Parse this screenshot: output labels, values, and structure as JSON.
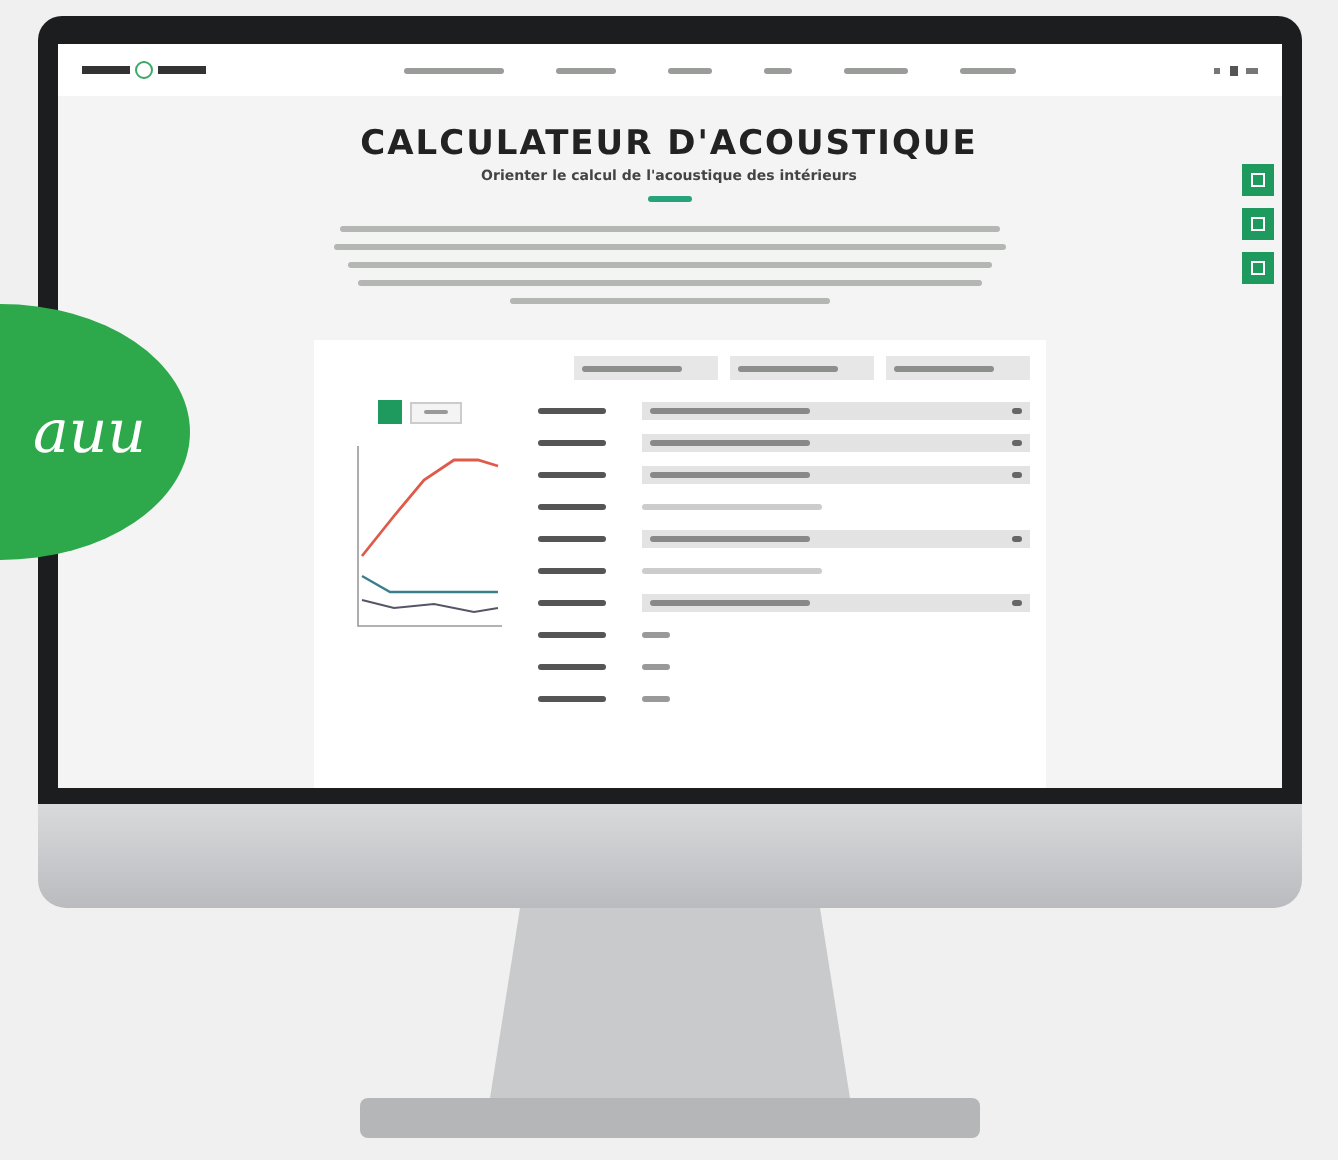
{
  "badge": {
    "text": "auu"
  },
  "page": {
    "title": "CALCULATEUR D'ACOUSTIQUE",
    "subtitle": "Orienter le calcul de l'acoustique des intérieurs"
  }
}
